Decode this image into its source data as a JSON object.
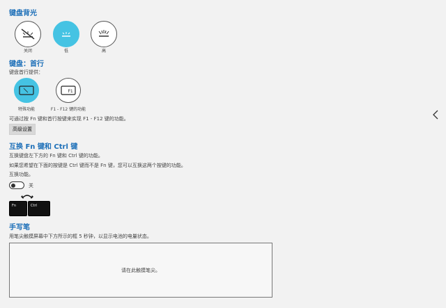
{
  "backlight": {
    "title": "键盘背光",
    "options": [
      {
        "label": "关闭",
        "icon": "backlight-off-icon",
        "selected": false
      },
      {
        "label": "低",
        "icon": "backlight-low-icon",
        "selected": true
      },
      {
        "label": "高",
        "icon": "backlight-high-icon",
        "selected": false
      }
    ]
  },
  "top_row": {
    "title": "键盘：首行",
    "subtitle": "键盘首行提供：",
    "options": [
      {
        "label": "特殊功能",
        "icon": "special-function-icon",
        "selected": true
      },
      {
        "label": "F1 - F12 键的功能",
        "key_text": "F1",
        "icon": "f1-key-icon",
        "selected": false
      }
    ],
    "description": "可通过按 Fn 键和首行按键来实现 F1 - F12 键的功能。",
    "advanced_button": "高级设置"
  },
  "swap": {
    "title": "互换 Fn 键和 Ctrl 键",
    "line1": "互换键盘左下方的 Fn 键和 Ctrl 键的功能。",
    "line2": "如果您希望在下面的按键是 Ctrl 键而不是 Fn 键，您可以互换这两个按键的功能。",
    "line3": "互换功能。",
    "toggle_state": "关",
    "key_left": "Fn",
    "key_right": "Ctrl"
  },
  "pen": {
    "title": "手写笔",
    "description": "用笔尖触摸屏幕中下方所示的框 5 秒钟，以显示电池的电量状态。",
    "pad_text": "请在此触摸笔尖。"
  },
  "colors": {
    "accent": "#1c6fb8",
    "selected": "#45c3e3"
  }
}
